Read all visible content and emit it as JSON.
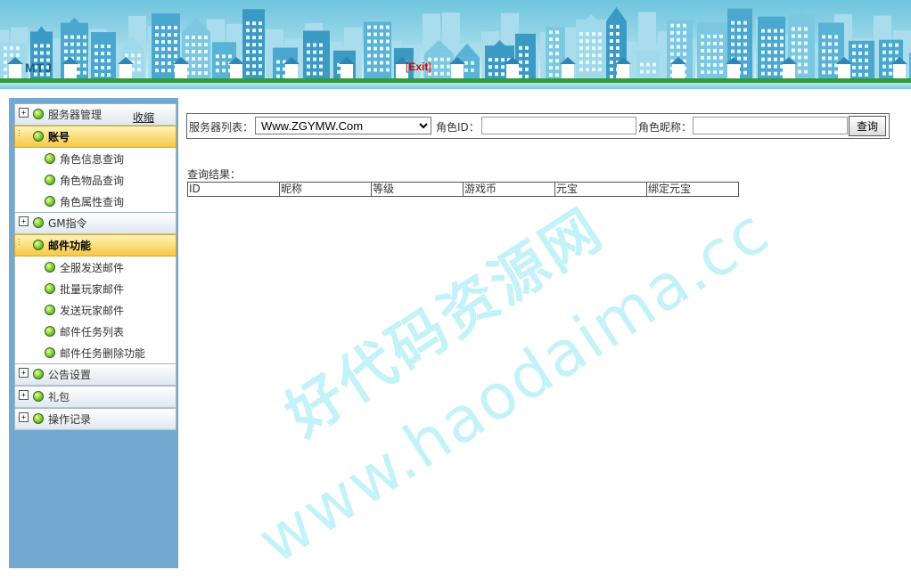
{
  "header": {
    "title": "MTJ",
    "exit_open": "[",
    "exit_label": "Exit",
    "exit_close": "]"
  },
  "sidebar": {
    "collapse_label": "收缩",
    "groups": [
      {
        "label": "服务器管理",
        "expanded": false
      },
      {
        "label": "账号",
        "expanded": true,
        "items": [
          "角色信息查询",
          "角色物品查询",
          "角色属性查询"
        ]
      },
      {
        "label": "GM指令",
        "expanded": false
      },
      {
        "label": "邮件功能",
        "expanded": true,
        "items": [
          "全服发送邮件",
          "批量玩家邮件",
          "发送玩家邮件",
          "邮件任务列表",
          "邮件任务删除功能"
        ]
      },
      {
        "label": "公告设置",
        "expanded": false
      },
      {
        "label": "礼包",
        "expanded": false
      },
      {
        "label": "操作记录",
        "expanded": false
      }
    ]
  },
  "search": {
    "server_label": "服务器列表：",
    "server_selected": "Www.ZGYMW.Com",
    "role_id_label": "角色ID：",
    "role_id_value": "",
    "role_name_label": "角色昵称：",
    "role_name_value": "",
    "query_button": "查询"
  },
  "results": {
    "label": "查询结果：",
    "columns": [
      "ID",
      "昵称",
      "等级",
      "游戏币",
      "元宝",
      "绑定元宝"
    ]
  },
  "watermark": {
    "line1": "好代码资源网",
    "line2": "www.haodaima.cc"
  },
  "colors": {
    "sidebar_bg": "#73a8d1",
    "active_group": "#f6c946",
    "exit": "#dd0000",
    "ground": "#2e9c3c"
  }
}
